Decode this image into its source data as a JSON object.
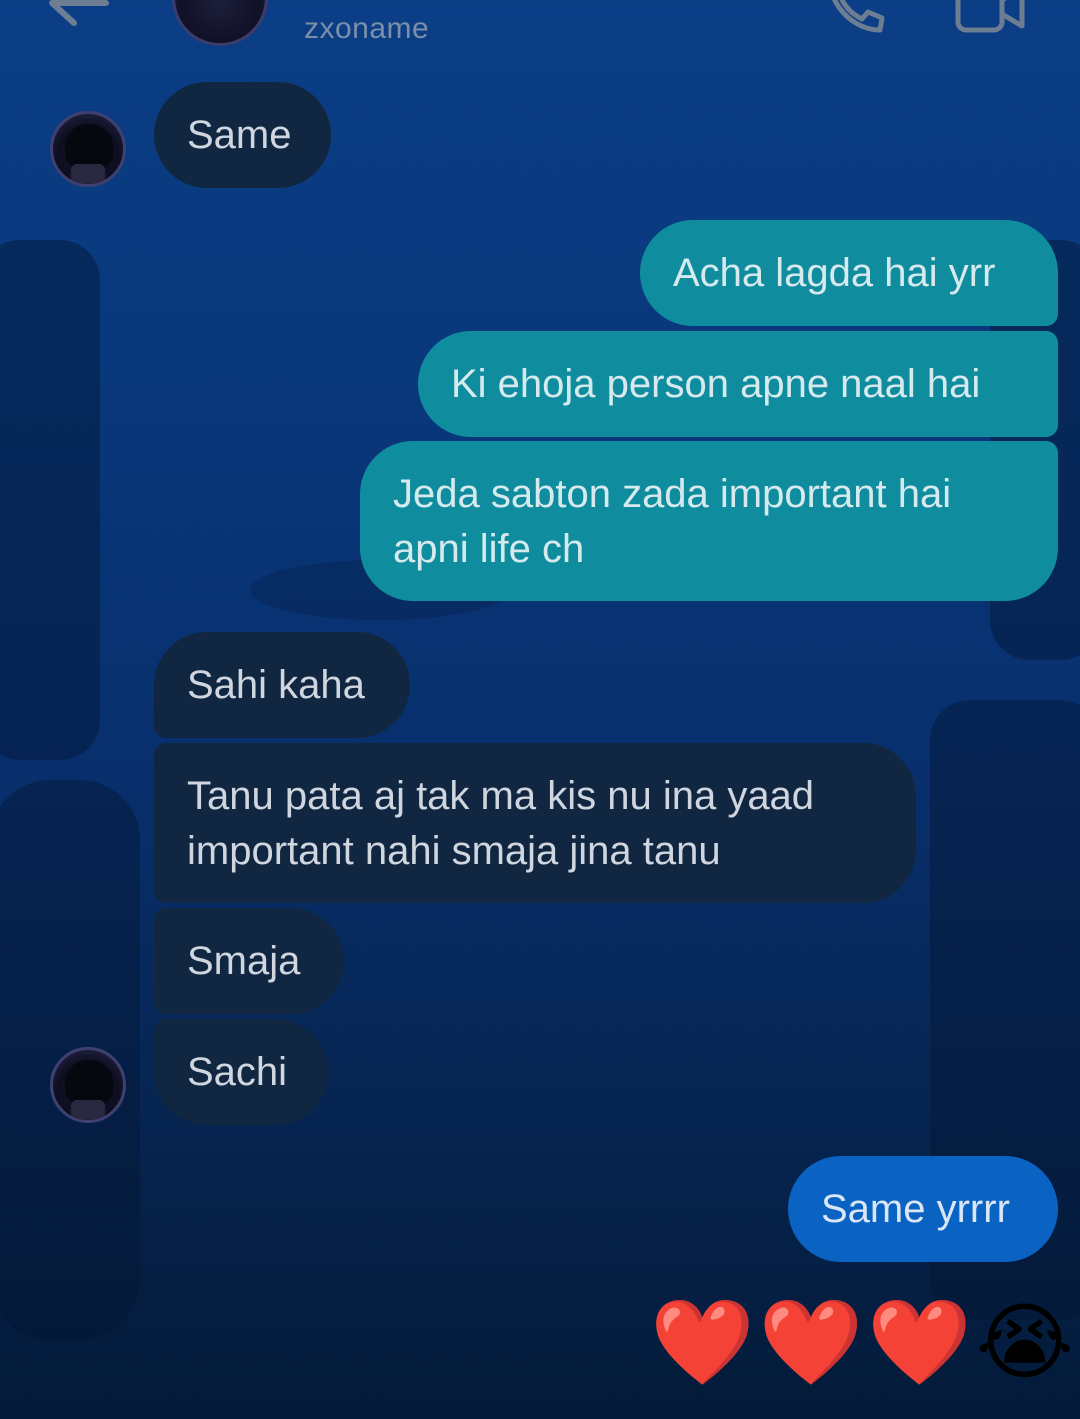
{
  "header": {
    "username": "zxoname",
    "back_icon": "arrow-left-icon",
    "call_icon": "phone-icon",
    "video_icon": "video-camera-icon"
  },
  "colors": {
    "incoming_bubble": "#112741",
    "outgoing_bubble": "#0f8c9e",
    "last_outgoing_bubble": "#0a63c2",
    "background": "#09387c"
  },
  "messages": [
    {
      "from": "them",
      "text": "Same"
    },
    {
      "from": "me",
      "text": "Acha lagda hai yrr"
    },
    {
      "from": "me",
      "text": "Ki ehoja person apne naal hai"
    },
    {
      "from": "me",
      "text": "Jeda sabton zada important hai\napni life ch"
    },
    {
      "from": "them",
      "text": "Sahi kaha"
    },
    {
      "from": "them",
      "text": "Tanu pata aj tak ma kis nu ina yaad\nimportant nahi smaja jina tanu"
    },
    {
      "from": "them",
      "text": "Smaja"
    },
    {
      "from": "them",
      "text": "Sachi"
    },
    {
      "from": "me",
      "text": "Same yrrrr"
    }
  ],
  "reaction_message": "❤️❤️❤️😭"
}
